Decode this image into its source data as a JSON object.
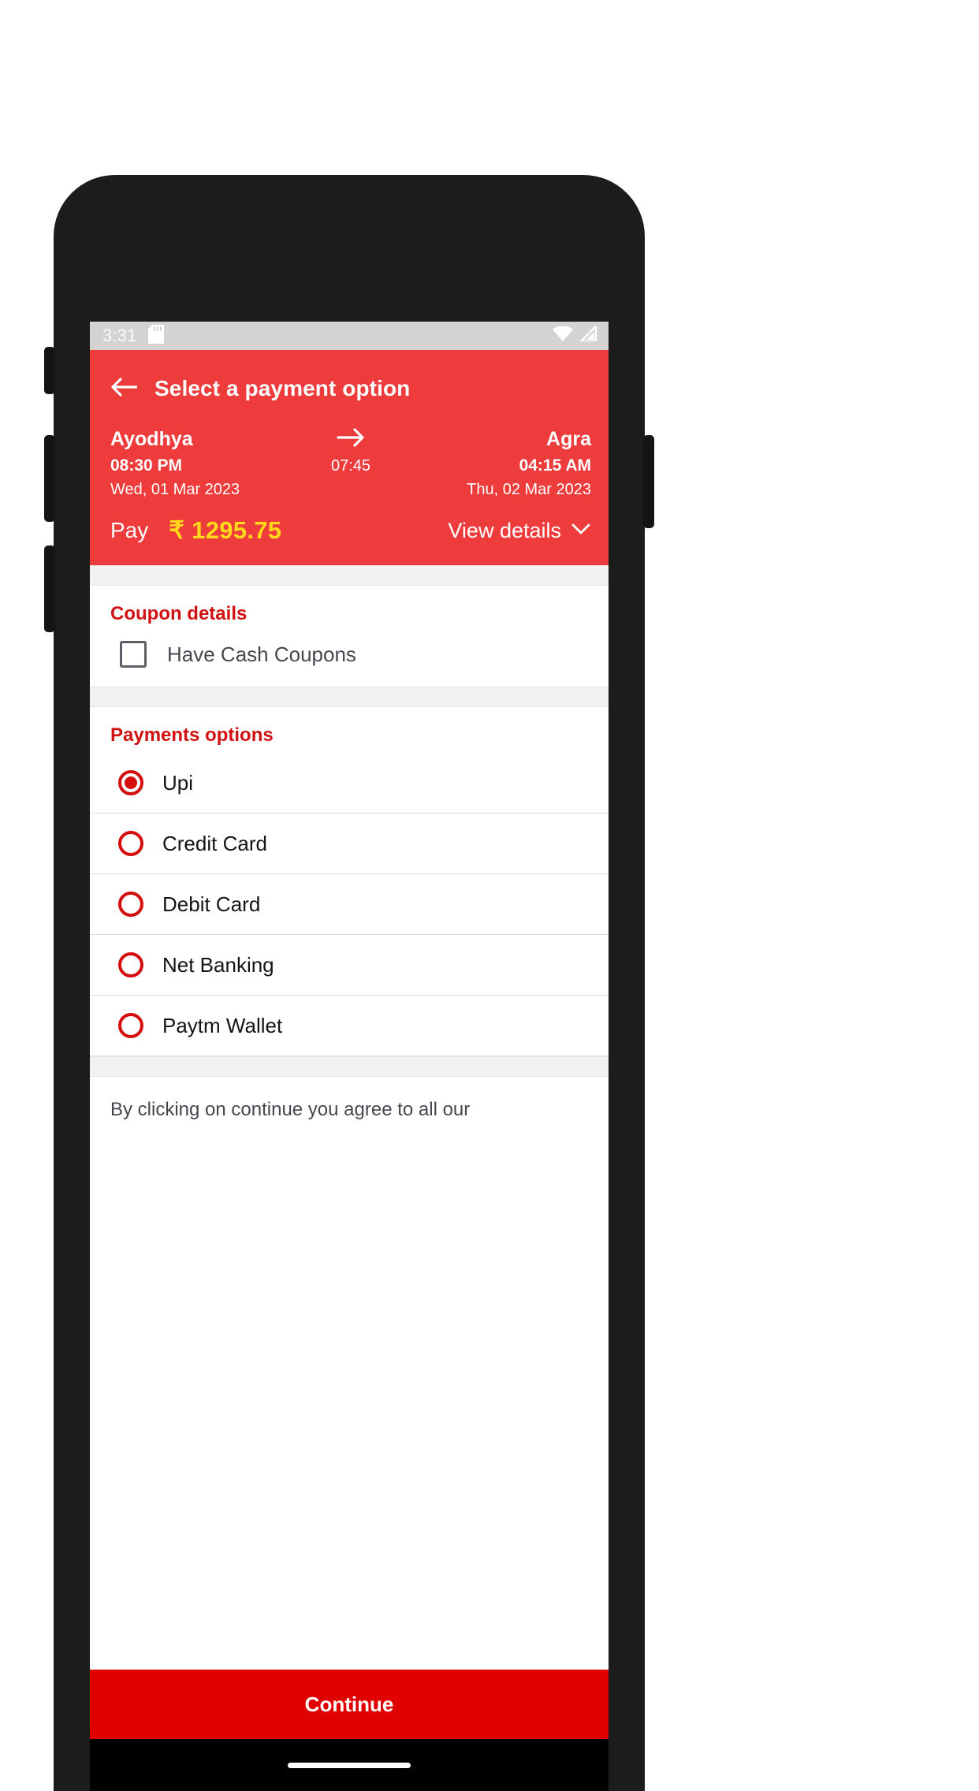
{
  "status_bar": {
    "time": "3:31",
    "icons": [
      "sd-card-icon",
      "wifi-icon",
      "signal-icon"
    ]
  },
  "app_bar": {
    "back_icon": "arrow-left-icon",
    "title": "Select a payment option"
  },
  "journey": {
    "origin_city": "Ayodhya",
    "destination_city": "Agra",
    "direction_icon": "arrow-right-icon",
    "departure_time": "08:30 PM",
    "arrival_time": "04:15 AM",
    "duration": "07:45",
    "departure_date": "Wed, 01 Mar 2023",
    "arrival_date": "Thu, 02 Mar 2023"
  },
  "pay": {
    "label": "Pay",
    "amount": "₹ 1295.75",
    "view_details_label": "View details",
    "chevron_icon": "chevron-down-icon",
    "amount_color": "#ffd91a"
  },
  "coupon": {
    "title": "Coupon details",
    "checkbox_label": "Have Cash Coupons",
    "checked": false
  },
  "payments": {
    "title": "Payments options",
    "options": [
      {
        "label": "Upi",
        "selected": true
      },
      {
        "label": "Credit Card",
        "selected": false
      },
      {
        "label": "Debit Card",
        "selected": false
      },
      {
        "label": "Net Banking",
        "selected": false
      },
      {
        "label": "Paytm Wallet",
        "selected": false
      }
    ]
  },
  "footer": {
    "terms_text": "By clicking on continue you agree to all our",
    "continue_label": "Continue"
  },
  "theme": {
    "header_red": "#ee3b3b",
    "accent_red": "#d11010",
    "button_red": "#e00000",
    "amount_yellow": "#ffd91a"
  }
}
